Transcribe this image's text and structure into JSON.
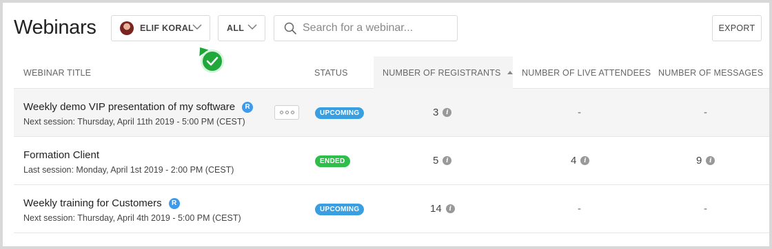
{
  "header": {
    "title": "Webinars",
    "user_filter": "ELIF KORAL",
    "type_filter": "ALL",
    "search_placeholder": "Search for a webinar...",
    "export_label": "EXPORT"
  },
  "table": {
    "columns": {
      "title": "WEBINAR TITLE",
      "status": "STATUS",
      "registrants": "NUMBER OF REGISTRANTS",
      "attendees": "NUMBER OF LIVE ATTENDEES",
      "messages": "NUMBER OF MESSAGES"
    },
    "sort_column": "registrants",
    "sort_direction": "ascending",
    "rows": [
      {
        "title": "Weekly demo VIP presentation of my software",
        "badge": "R",
        "session": "Next session: Thursday, April 11th 2019 - 5:00 PM (CEST)",
        "status": "UPCOMING",
        "registrants": "3",
        "attendees": "-",
        "messages": "-"
      },
      {
        "title": "Formation Client",
        "session": "Last session: Monday, April 1st 2019 - 2:00 PM (CEST)",
        "status": "ENDED",
        "registrants": "5",
        "attendees": "4",
        "messages": "9"
      },
      {
        "title": "Weekly training for Customers",
        "badge": "R",
        "session": "Next session: Thursday, April 4th 2019 - 5:00 PM (CEST)",
        "status": "UPCOMING",
        "registrants": "14",
        "attendees": "-",
        "messages": "-"
      }
    ]
  },
  "icons": {
    "chevron": "chevron-down-icon",
    "search": "search-icon",
    "more": "more-options-icon",
    "info": "info-icon",
    "check": "check-icon",
    "sort": "sort-ascending-icon"
  },
  "colors": {
    "upcoming": "#3a9fe0",
    "ended": "#2fbd4b",
    "r_badge": "#3d9be9",
    "check_badge": "#20a83b"
  },
  "info_glyph": "i"
}
